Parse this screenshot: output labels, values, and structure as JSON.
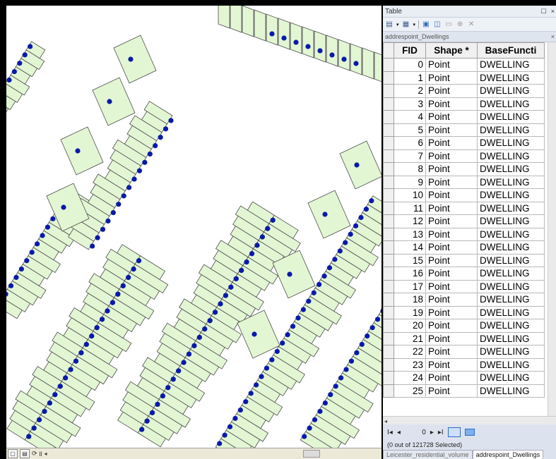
{
  "table_window": {
    "title": "Table",
    "layer_name": "addrespoint_Dwellings",
    "columns": [
      "FID",
      "Shape *",
      "BaseFuncti"
    ],
    "rows": [
      {
        "fid": "0",
        "shape": "Point",
        "base": "DWELLING"
      },
      {
        "fid": "1",
        "shape": "Point",
        "base": "DWELLING"
      },
      {
        "fid": "2",
        "shape": "Point",
        "base": "DWELLING"
      },
      {
        "fid": "3",
        "shape": "Point",
        "base": "DWELLING"
      },
      {
        "fid": "4",
        "shape": "Point",
        "base": "DWELLING"
      },
      {
        "fid": "5",
        "shape": "Point",
        "base": "DWELLING"
      },
      {
        "fid": "6",
        "shape": "Point",
        "base": "DWELLING"
      },
      {
        "fid": "7",
        "shape": "Point",
        "base": "DWELLING"
      },
      {
        "fid": "8",
        "shape": "Point",
        "base": "DWELLING"
      },
      {
        "fid": "9",
        "shape": "Point",
        "base": "DWELLING"
      },
      {
        "fid": "10",
        "shape": "Point",
        "base": "DWELLING"
      },
      {
        "fid": "11",
        "shape": "Point",
        "base": "DWELLING"
      },
      {
        "fid": "12",
        "shape": "Point",
        "base": "DWELLING"
      },
      {
        "fid": "13",
        "shape": "Point",
        "base": "DWELLING"
      },
      {
        "fid": "14",
        "shape": "Point",
        "base": "DWELLING"
      },
      {
        "fid": "15",
        "shape": "Point",
        "base": "DWELLING"
      },
      {
        "fid": "16",
        "shape": "Point",
        "base": "DWELLING"
      },
      {
        "fid": "17",
        "shape": "Point",
        "base": "DWELLING"
      },
      {
        "fid": "18",
        "shape": "Point",
        "base": "DWELLING"
      },
      {
        "fid": "19",
        "shape": "Point",
        "base": "DWELLING"
      },
      {
        "fid": "20",
        "shape": "Point",
        "base": "DWELLING"
      },
      {
        "fid": "21",
        "shape": "Point",
        "base": "DWELLING"
      },
      {
        "fid": "22",
        "shape": "Point",
        "base": "DWELLING"
      },
      {
        "fid": "23",
        "shape": "Point",
        "base": "DWELLING"
      },
      {
        "fid": "24",
        "shape": "Point",
        "base": "DWELLING"
      },
      {
        "fid": "25",
        "shape": "Point",
        "base": "DWELLING"
      }
    ],
    "nav": {
      "position": "0"
    },
    "selection_status": "(0 out of 121728 Selected)",
    "tabs": [
      "Leicester_residential_volume",
      "addrespoint_Dwellings"
    ],
    "active_tab": 1
  },
  "colors": {
    "parcel_fill": "#e3f6d4",
    "parcel_stroke": "#4a4a4a",
    "point": "#0a1aa8"
  },
  "icons": [
    "table-options-icon",
    "related-tables-icon",
    "select-by-attributes-icon",
    "switch-selection-icon",
    "clear-selection-icon",
    "zoom-to-selected-icon",
    "delete-selected-icon",
    "close-icon"
  ]
}
